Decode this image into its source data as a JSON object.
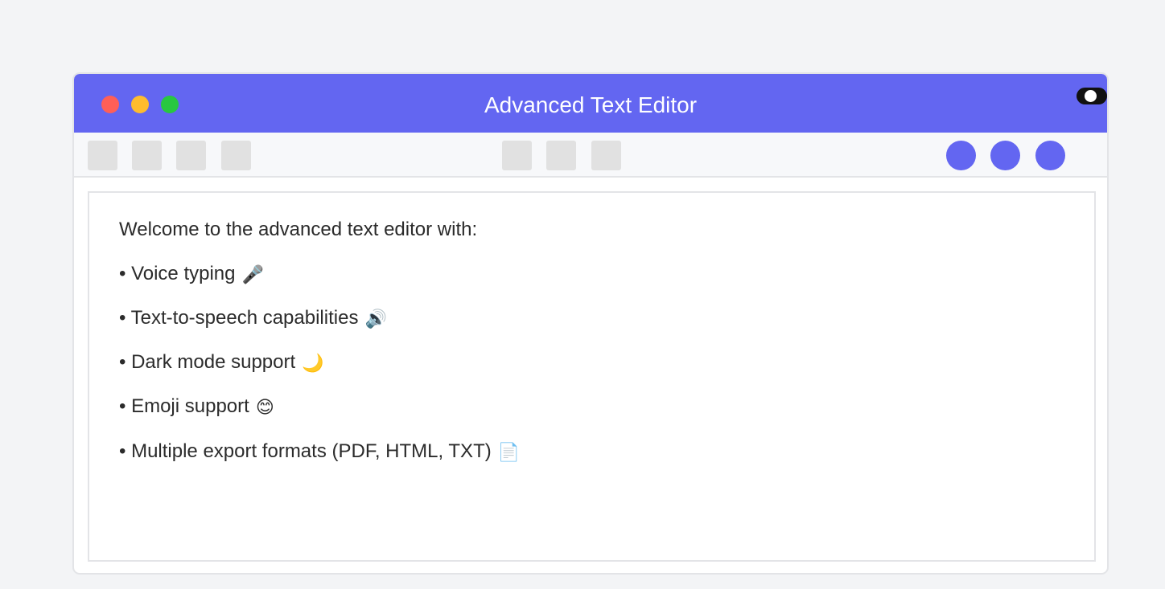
{
  "window": {
    "title": "Advanced Text Editor",
    "accent_color": "#6366f1"
  },
  "titlebar": {
    "controls": [
      "close",
      "minimize",
      "maximize"
    ],
    "theme_toggle": "dark-mode-toggle"
  },
  "editor": {
    "intro": "Welcome to the advanced text editor with:",
    "features": [
      {
        "text": "• Voice typing",
        "emoji": "🎤"
      },
      {
        "text": "• Text-to-speech capabilities",
        "emoji": "🔊"
      },
      {
        "text": "• Dark mode support",
        "emoji": "🌙"
      },
      {
        "text": "• Emoji support",
        "emoji": "😊"
      },
      {
        "text": "• Multiple export formats (PDF, HTML, TXT)",
        "emoji": "📄"
      }
    ]
  }
}
